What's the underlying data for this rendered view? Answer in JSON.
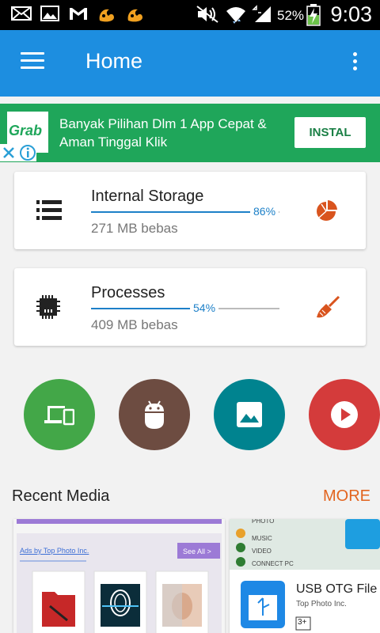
{
  "status_bar": {
    "battery_percent": "52%",
    "time": "9:03"
  },
  "app_bar": {
    "title": "Home"
  },
  "ad": {
    "brand": "Grab",
    "text": "Banyak Pilihan Dlm 1 App Cepat & Aman Tinggal Klik",
    "install_label": "INSTAL"
  },
  "storage_card": {
    "title": "Internal Storage",
    "usage_percent": 86,
    "usage_label": "86%",
    "free_label": "271 MB bebas"
  },
  "processes_card": {
    "title": "Processes",
    "usage_percent": 54,
    "usage_label": "54%",
    "free_label": "409 MB bebas"
  },
  "shortcuts": [
    {
      "name": "apps",
      "color": "#43a748"
    },
    {
      "name": "android",
      "color": "#6d4c41"
    },
    {
      "name": "images",
      "color": "#00838f"
    },
    {
      "name": "video",
      "color": "#d43b3b"
    }
  ],
  "recent_media": {
    "title": "Recent Media",
    "more_label": "MORE",
    "items": [
      {
        "ad_label": "Ads by Top Photo Inc.",
        "see_all": "See All >"
      },
      {
        "menu": [
          "PHOTO",
          "MUSIC",
          "VIDEO",
          "CONNECT PC"
        ],
        "app_title": "USB OTG File",
        "app_dev": "Top Photo Inc.",
        "badge": "3+"
      }
    ]
  },
  "colors": {
    "primary": "#1d8ee0",
    "accent": "#e2641f",
    "ad_green": "#1fa65a"
  }
}
